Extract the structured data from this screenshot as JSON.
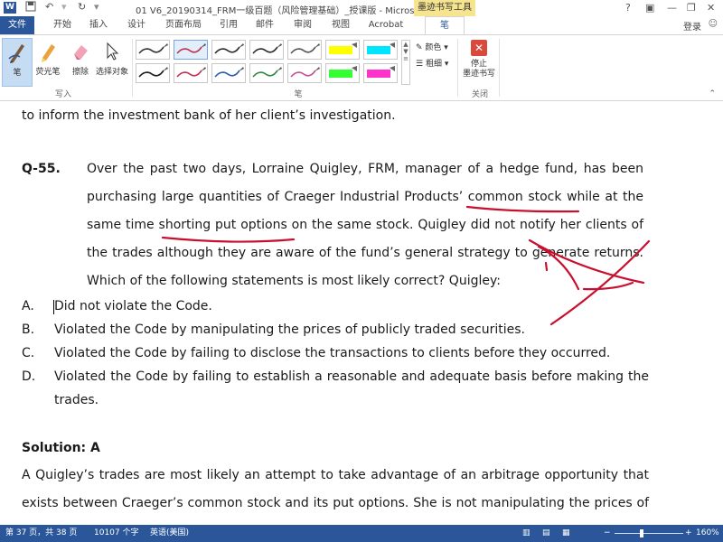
{
  "titlebar": {
    "app_icon": "W",
    "title": "01 V6_20190314_FRM一级百题（风险管理基础）_授课版 - Microsoft Word",
    "context_tool": "墨迹书写工具",
    "help": "?",
    "minimize": "—",
    "restore": "❐",
    "close": "✕"
  },
  "tabs": {
    "items": [
      "文件",
      "开始",
      "插入",
      "设计",
      "页面布局",
      "引用",
      "邮件",
      "审阅",
      "视图",
      "Acrobat",
      "笔"
    ],
    "login": "登录"
  },
  "ribbon": {
    "write_group": {
      "pen": "笔",
      "highlighter": "荧光笔",
      "eraser": "擦除",
      "select": "选择对象",
      "label": "写入"
    },
    "pens_group": {
      "label": "笔",
      "pens": [
        {
          "color": "#333333"
        },
        {
          "color": "#c0334d"
        },
        {
          "color": "#2b2b2b"
        },
        {
          "color": "#2b2b2b"
        },
        {
          "color": "#555555"
        },
        {
          "color": "#ffff00"
        },
        {
          "color": "#00e5ff"
        },
        {
          "color": "#1a1a1a"
        },
        {
          "color": "#c0334d"
        },
        {
          "color": "#2a5bb0"
        },
        {
          "color": "#2f8a3e"
        },
        {
          "color": "#c84e9a"
        },
        {
          "color": "#33ff33"
        },
        {
          "color": "#ff33cc"
        }
      ],
      "color_label": "颜色",
      "thickness_label": "粗细"
    },
    "close_group": {
      "stop_label_1": "停止",
      "stop_label_2": "墨迹书写",
      "label": "关闭"
    }
  },
  "document": {
    "line0": "to inform the investment bank of her client’s investigation.",
    "q_number": "Q-55.",
    "q_lines": [
      "Over the past two days, Lorraine Quigley, FRM, manager of a hedge fund, has been",
      "purchasing large quantities of Craeger Industrial Products’ common stock while at the",
      "same time shorting put options on the same stock. Quigley did not notify her clients of",
      "the trades although they are aware of the fund’s general strategy to generate returns.",
      "Which of the following statements is most likely correct? Quigley:"
    ],
    "options": [
      {
        "letter": "A.",
        "text": "Did not violate the Code."
      },
      {
        "letter": "B.",
        "text": "Violated the Code by manipulating the prices of publicly traded securities."
      },
      {
        "letter": "C.",
        "text": "Violated the Code by failing to disclose the transactions to clients before they occurred."
      },
      {
        "letter": "D.",
        "text": "Violated the Code by failing to establish a reasonable and adequate basis before making the"
      }
    ],
    "option_d_cont": "trades.",
    "solution_heading": "Solution: A",
    "solution_lines": [
      "A Quigley’s trades are most likely an attempt to take advantage of an arbitrage opportunity that",
      "exists between Craeger’s common stock and its put options. She is not manipulating the prices of"
    ],
    "ink_color": "#c8102e"
  },
  "statusbar": {
    "page": "第 37 页，共 38 页",
    "words": "10107 个字",
    "language": "英语(美国)",
    "zoom_minus": "−",
    "zoom_plus": "+",
    "zoom": "160%",
    "zoom_fraction": 0.4
  }
}
